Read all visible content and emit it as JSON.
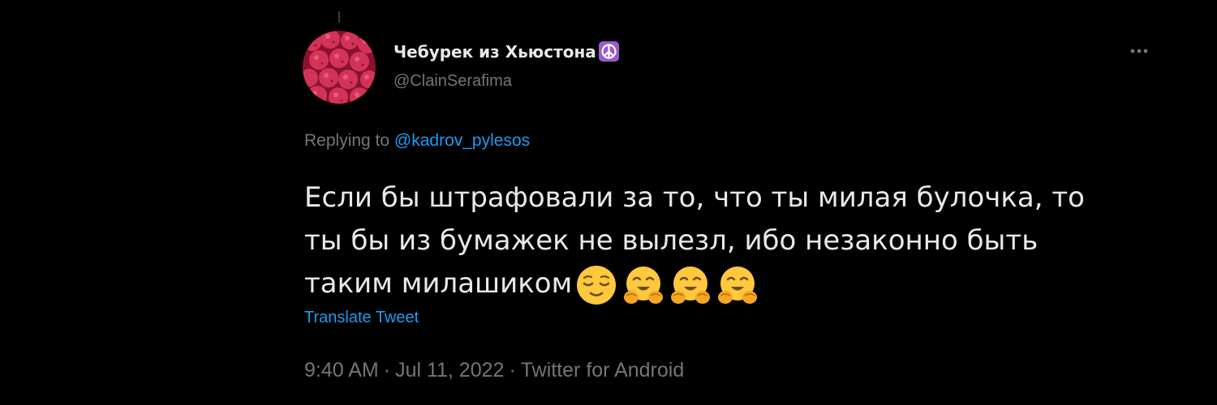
{
  "tweet": {
    "author": {
      "display_name": "Чебурек из Хьюстона",
      "name_emoji": "peace-symbol-icon",
      "handle": "@ClainSerafima",
      "avatar": "raspberries-avatar"
    },
    "more_icon": "more-dots-icon",
    "replying": {
      "prefix": "Replying to",
      "mention": "@kadrov_pylesos"
    },
    "text_lines": [
      "Если бы штрафовали за то, что ты милая булочка, то",
      "ты бы из бумажек не вылезл, ибо незаконно быть",
      "таким милашиком"
    ],
    "emojis": [
      "relieved-face-icon",
      "hugging-face-icon",
      "hugging-face-icon",
      "hugging-face-icon"
    ],
    "translate_label": "Translate Tweet",
    "time": "9:40 AM",
    "date": "Jul 11, 2022",
    "source": "Twitter for Android",
    "separator": "·"
  },
  "colors": {
    "background": "#000000",
    "text": "#e7e9ea",
    "secondary": "#71767b",
    "accent": "#1d9bf0",
    "emoji": "#ffc83d"
  }
}
